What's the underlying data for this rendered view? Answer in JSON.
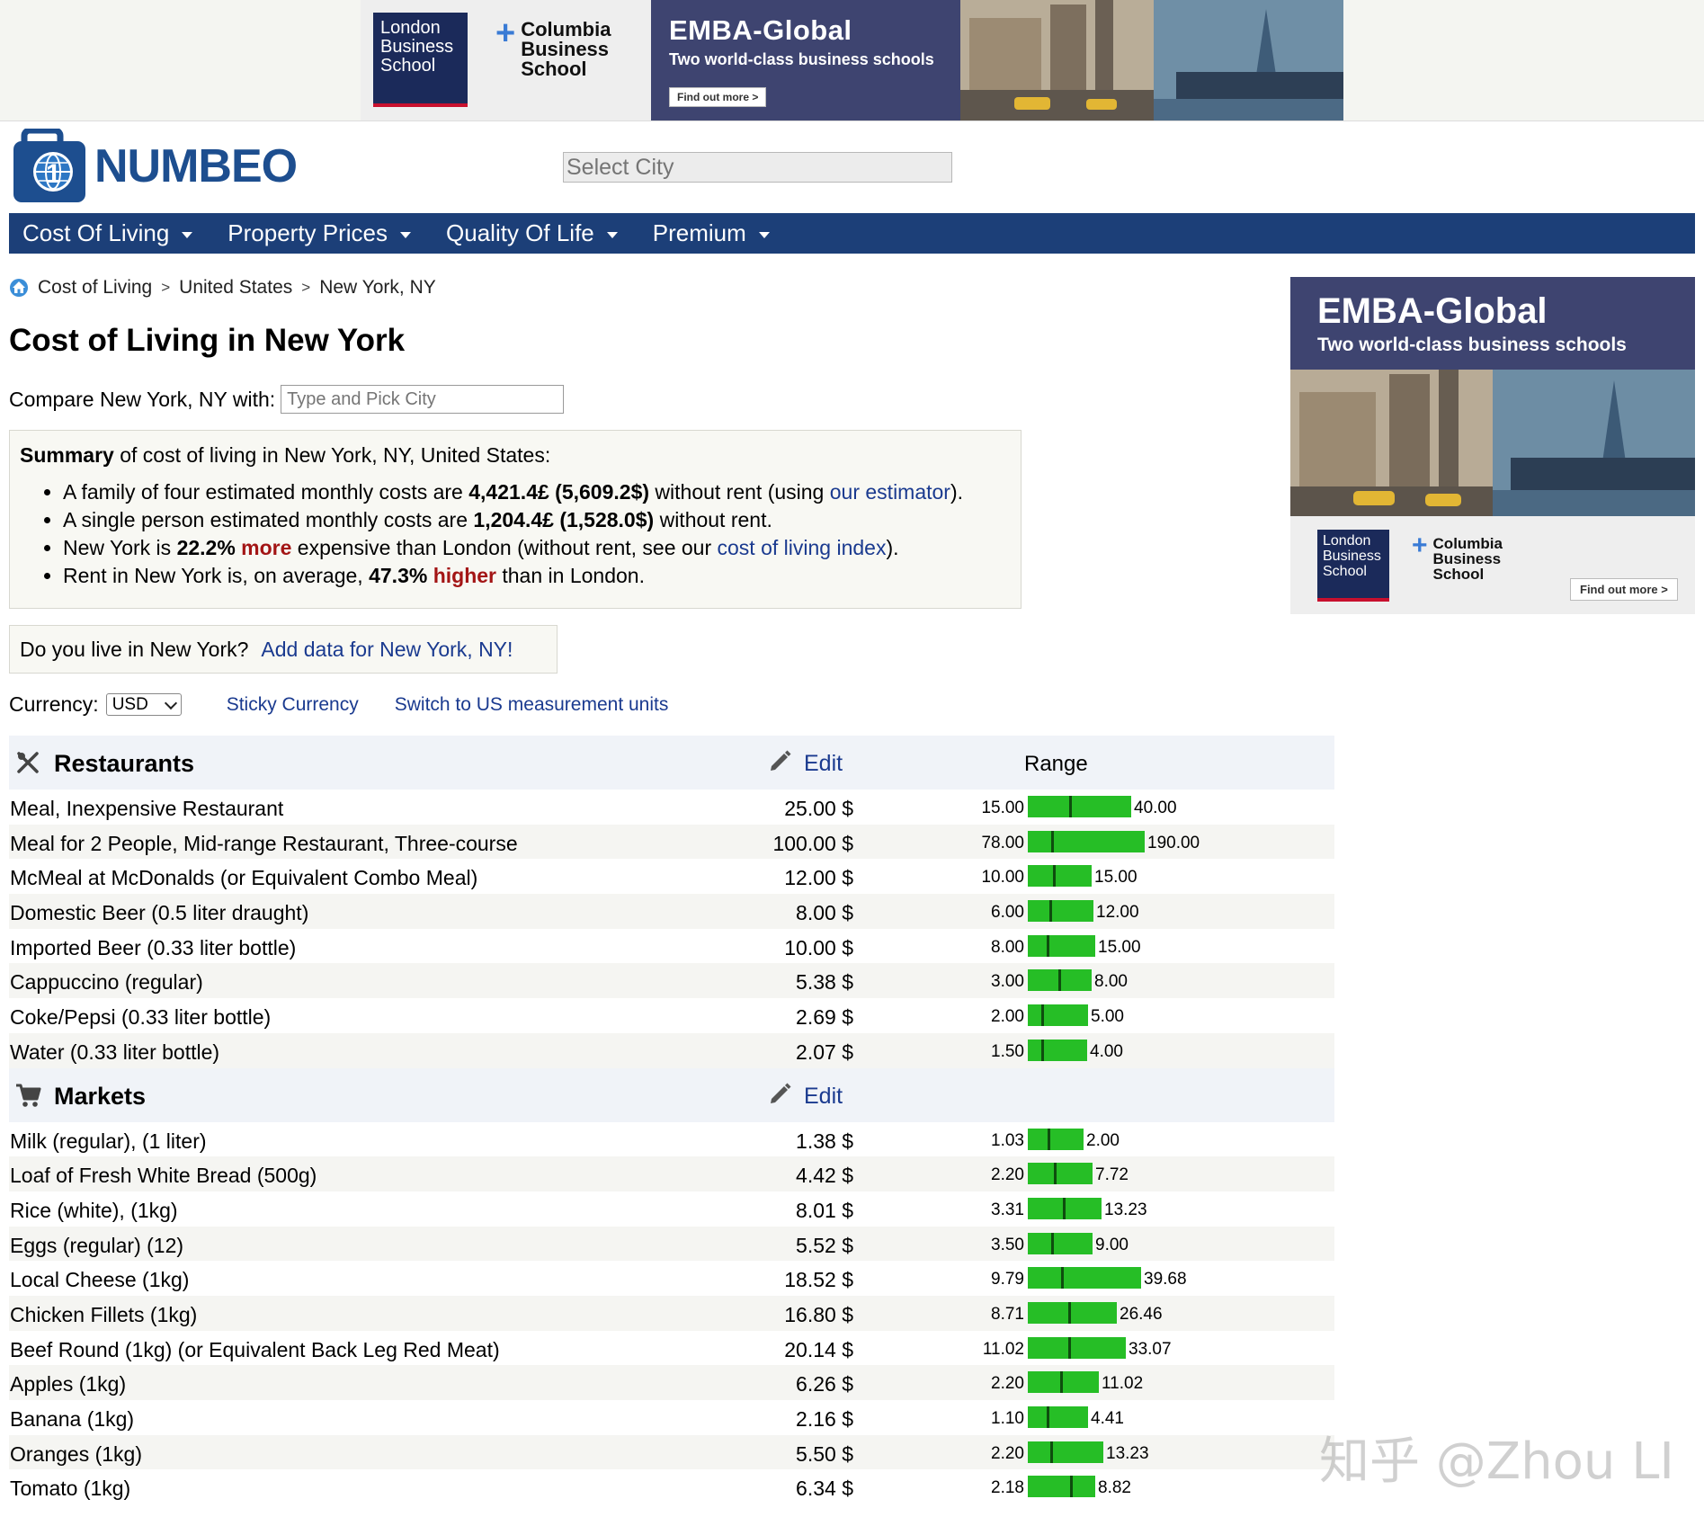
{
  "top_ad": {
    "lbs_logo": "London Business School",
    "cbs_logo": "Columbia Business School",
    "headline": "EMBA-Global",
    "tagline": "Two world-class business schools",
    "cta": "Find out more >"
  },
  "header": {
    "logo_text": "NUMBEO",
    "city_select_placeholder": "Select City"
  },
  "nav": {
    "items": [
      {
        "label": "Cost Of Living"
      },
      {
        "label": "Property Prices"
      },
      {
        "label": "Quality Of Life"
      },
      {
        "label": "Premium"
      }
    ]
  },
  "breadcrumb": {
    "items": [
      "Cost of Living",
      "United States",
      "New York, NY"
    ],
    "separator": ">"
  },
  "page_title": "Cost of Living in New York",
  "compare": {
    "label": "Compare New York, NY with:",
    "placeholder": "Type and Pick City"
  },
  "summary": {
    "heading_bold": "Summary",
    "heading_rest": " of cost of living in New York, NY, United States:",
    "family": {
      "pre": "A family of four estimated monthly costs are ",
      "value": "4,421.4£ (5,609.2$)",
      "mid": " without rent (using ",
      "link": "our estimator",
      "post": ")."
    },
    "single": {
      "pre": "A single person estimated monthly costs are ",
      "value": "1,204.4£ (1,528.0$)",
      "post": " without rent."
    },
    "index": {
      "pre": "New York is ",
      "value": "22.2%",
      "word": "more",
      "mid": " expensive than London (without rent, see our ",
      "link": "cost of living index",
      "post": ")."
    },
    "rent": {
      "pre": "Rent in New York is, on average, ",
      "value": "47.3%",
      "word": "higher",
      "post": " than in London."
    }
  },
  "live_box": {
    "question": "Do you live in New York?",
    "link": "Add data for New York, NY!"
  },
  "currency": {
    "label": "Currency:",
    "selected": "USD",
    "sticky_link": "Sticky Currency",
    "units_link": "Switch to US measurement units"
  },
  "table": {
    "edit_label": "Edit",
    "range_header": "Range",
    "categories": [
      {
        "name": "Restaurants",
        "icon": "fork-knife-icon",
        "show_range_header": true,
        "rows": [
          {
            "item": "Meal, Inexpensive Restaurant",
            "price": "25.00 $",
            "min": "15.00",
            "max": "40.00",
            "avg": 25.0,
            "lo": 15.0,
            "hi": 40.0
          },
          {
            "item": "Meal for 2 People, Mid-range Restaurant, Three-course",
            "price": "100.00 $",
            "min": "78.00",
            "max": "190.00",
            "avg": 100.0,
            "lo": 78.0,
            "hi": 190.0
          },
          {
            "item": "McMeal at McDonalds (or Equivalent Combo Meal)",
            "price": "12.00 $",
            "min": "10.00",
            "max": "15.00",
            "avg": 12.0,
            "lo": 10.0,
            "hi": 15.0
          },
          {
            "item": "Domestic Beer (0.5 liter draught)",
            "price": "8.00 $",
            "min": "6.00",
            "max": "12.00",
            "avg": 8.0,
            "lo": 6.0,
            "hi": 12.0
          },
          {
            "item": "Imported Beer (0.33 liter bottle)",
            "price": "10.00 $",
            "min": "8.00",
            "max": "15.00",
            "avg": 10.0,
            "lo": 8.0,
            "hi": 15.0
          },
          {
            "item": "Cappuccino (regular)",
            "price": "5.38 $",
            "min": "3.00",
            "max": "8.00",
            "avg": 5.38,
            "lo": 3.0,
            "hi": 8.0
          },
          {
            "item": "Coke/Pepsi (0.33 liter bottle)",
            "price": "2.69 $",
            "min": "2.00",
            "max": "5.00",
            "avg": 2.69,
            "lo": 2.0,
            "hi": 5.0
          },
          {
            "item": "Water (0.33 liter bottle)",
            "price": "2.07 $",
            "min": "1.50",
            "max": "4.00",
            "avg": 2.07,
            "lo": 1.5,
            "hi": 4.0
          }
        ]
      },
      {
        "name": "Markets",
        "icon": "shopping-cart-icon",
        "show_range_header": false,
        "rows": [
          {
            "item": "Milk (regular), (1 liter)",
            "price": "1.38 $",
            "min": "1.03",
            "max": "2.00",
            "avg": 1.38,
            "lo": 1.03,
            "hi": 2.0
          },
          {
            "item": "Loaf of Fresh White Bread (500g)",
            "price": "4.42 $",
            "min": "2.20",
            "max": "7.72",
            "avg": 4.42,
            "lo": 2.2,
            "hi": 7.72
          },
          {
            "item": "Rice (white), (1kg)",
            "price": "8.01 $",
            "min": "3.31",
            "max": "13.23",
            "avg": 8.01,
            "lo": 3.31,
            "hi": 13.23
          },
          {
            "item": "Eggs (regular) (12)",
            "price": "5.52 $",
            "min": "3.50",
            "max": "9.00",
            "avg": 5.52,
            "lo": 3.5,
            "hi": 9.0
          },
          {
            "item": "Local Cheese (1kg)",
            "price": "18.52 $",
            "min": "9.79",
            "max": "39.68",
            "avg": 18.52,
            "lo": 9.79,
            "hi": 39.68
          },
          {
            "item": "Chicken Fillets (1kg)",
            "price": "16.80 $",
            "min": "8.71",
            "max": "26.46",
            "avg": 16.8,
            "lo": 8.71,
            "hi": 26.46
          },
          {
            "item": "Beef Round (1kg) (or Equivalent Back Leg Red Meat)",
            "price": "20.14 $",
            "min": "11.02",
            "max": "33.07",
            "avg": 20.14,
            "lo": 11.02,
            "hi": 33.07
          },
          {
            "item": "Apples (1kg)",
            "price": "6.26 $",
            "min": "2.20",
            "max": "11.02",
            "avg": 6.26,
            "lo": 2.2,
            "hi": 11.02
          },
          {
            "item": "Banana (1kg)",
            "price": "2.16 $",
            "min": "1.10",
            "max": "4.41",
            "avg": 2.16,
            "lo": 1.1,
            "hi": 4.41
          },
          {
            "item": "Oranges (1kg)",
            "price": "5.50 $",
            "min": "2.20",
            "max": "13.23",
            "avg": 5.5,
            "lo": 2.2,
            "hi": 13.23
          },
          {
            "item": "Tomato (1kg)",
            "price": "6.34 $",
            "min": "2.18",
            "max": "8.82",
            "avg": 6.34,
            "lo": 2.18,
            "hi": 8.82
          }
        ]
      }
    ]
  },
  "side_ad": {
    "headline": "EMBA-Global",
    "tagline": "Two world-class business schools",
    "lbs_logo": "London Business School",
    "cbs_logo": "Columbia Business School",
    "cta": "Find out more >"
  },
  "watermark": "知乎 @Zhou LI",
  "colors": {
    "nav_bg": "#1c3f78",
    "logo_blue": "#1d4e8f",
    "link": "#1a3a8f",
    "range_bar": "#26be26",
    "range_marker": "#0e4d0e",
    "emphasis_red": "#a31515"
  }
}
